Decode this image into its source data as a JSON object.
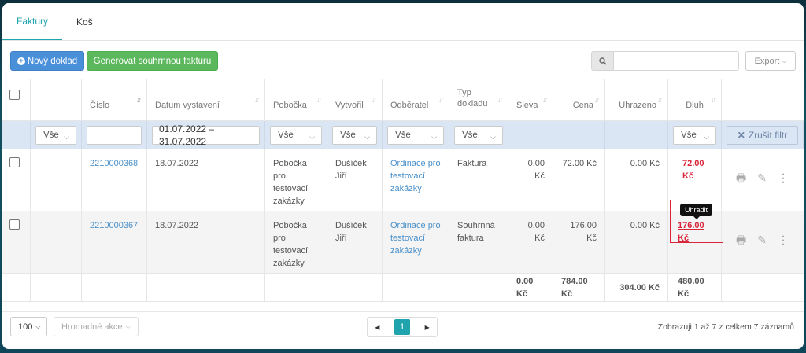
{
  "tabs": [
    {
      "label": "Faktury",
      "active": true
    },
    {
      "label": "Koš",
      "active": false
    }
  ],
  "toolbar": {
    "new_label": "Nový doklad",
    "generate_label": "Generovat souhrnnou fakturu",
    "search_placeholder": "",
    "export_label": "Export"
  },
  "columns": [
    "",
    "",
    "Číslo",
    "Datum vystavení",
    "Pobočka",
    "Vytvořil",
    "Odběratel",
    "Typ dokladu",
    "Sleva",
    "Cena",
    "Uhrazeno",
    "Dluh",
    ""
  ],
  "filters": {
    "col2": "Vše",
    "date_range": "01.07.2022 – 31.07.2022",
    "pobocka": "Vše",
    "vytvoril": "Vše",
    "odberatel": "Vše",
    "typ": "Vše",
    "dluh": "Vše",
    "clear_label": "Zrušit filtr"
  },
  "rows": [
    {
      "cislo": "2210000368",
      "datum": "18.07.2022",
      "pobocka": "Pobočka pro testovací zakázky",
      "vytvoril": "Dušíček Jiří",
      "odberatel": "Ordinace pro testovací zakázky",
      "typ": "Faktura",
      "sleva": "0.00 Kč",
      "cena": "72.00 Kč",
      "uhrazeno": "0.00 Kč",
      "dluh": "72.00 Kč"
    },
    {
      "cislo": "2210000367",
      "datum": "18.07.2022",
      "pobocka": "Pobočka pro testovací zakázky",
      "vytvoril": "Dušíček Jiří",
      "odberatel": "Ordinace pro testovací zakázky",
      "typ": "Souhrnná faktura",
      "sleva": "0.00 Kč",
      "cena": "176.00 Kč",
      "uhrazeno": "0.00 Kč",
      "dluh": "176.00 Kč"
    }
  ],
  "totals": {
    "sleva": "0.00 Kč",
    "cena": "784.00 Kč",
    "uhrazeno": "304.00 Kč",
    "dluh": "480.00 Kč"
  },
  "tooltip": "Uhradit",
  "footer": {
    "page_size": "100",
    "bulk_label": "Hromadné akce",
    "current_page": "1",
    "info": "Zobrazuji 1 až 7 z celkem 7 záznamů"
  },
  "colors": {
    "accent": "#1fa4ae",
    "primary_blue": "#4a90d9",
    "green": "#5cb85c",
    "debt_red": "#d9263b",
    "filter_bg": "#dbe6f5"
  }
}
